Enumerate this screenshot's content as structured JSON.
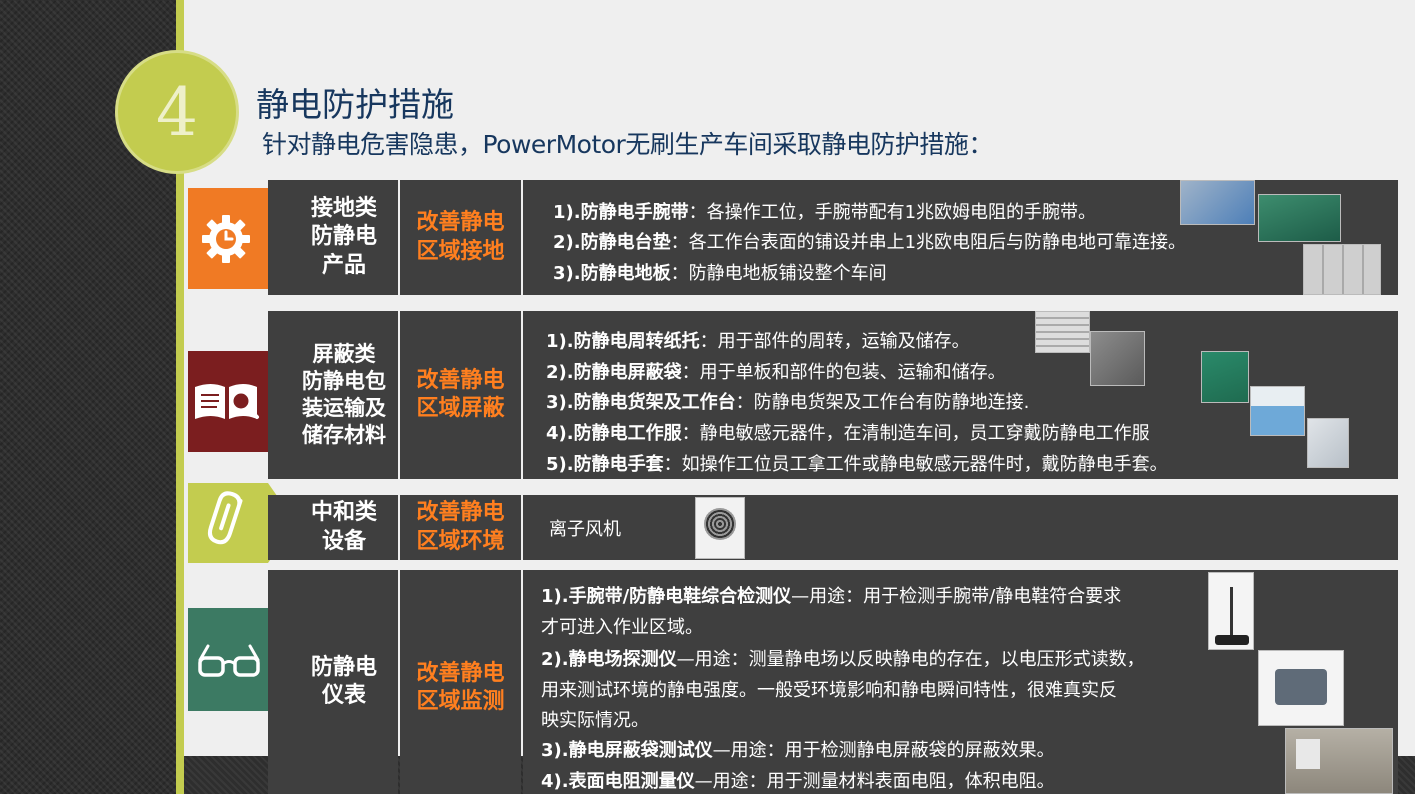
{
  "slide": {
    "number": "4",
    "title": "静电防护措施",
    "subtitle": "针对静电危害隐患，PowerMotor无刷生产车间采取静电防护措施："
  },
  "colors": {
    "accent_green": "#c3cc4f",
    "orange": "#f07a24",
    "dark_red": "#7b1e1f",
    "teal": "#3c7a63",
    "text_orange": "#ff7f1f",
    "cell_gray": "#3f3f3f",
    "title_navy": "#17375e"
  },
  "rows": [
    {
      "icon": "gear-clock-icon",
      "category": "接地类\n防静电\n产品",
      "goal": "改善静电\n区域接地",
      "items": [
        {
          "label": "1).防静电手腕带",
          "text": "：各操作工位，手腕带配有1兆欧姆电阻的手腕带。"
        },
        {
          "label": "2).防静电台垫",
          "text": "：各工作台表面的铺设并串上1兆欧电阻后与防静电地可靠连接。"
        },
        {
          "label": "3).防静电地板",
          "text": "：防静电地板铺设整个车间"
        }
      ]
    },
    {
      "icon": "book-search-icon",
      "category": "屏蔽类\n防静电包\n装运输及\n储存材料",
      "goal": "改善静电\n区域屏蔽",
      "items": [
        {
          "label": "1).防静电周转纸托",
          "text": "：用于部件的周转，运输及储存。"
        },
        {
          "label": "2).防静电屏蔽袋",
          "text": "：用于单板和部件的包装、运输和储存。"
        },
        {
          "label": "3).防静电货架及工作台",
          "text": "：防静电货架及工作台有防静地连接."
        },
        {
          "label": "4).防静电工作服",
          "text": "：静电敏感元器件，在清制造车间，员工穿戴防静电工作服"
        },
        {
          "label": "5).防静电手套",
          "text": "：如操作工位员工拿工件或静电敏感元器件时，戴防静电手套。"
        }
      ]
    },
    {
      "icon": "paperclip-icon",
      "category": "中和类\n设备",
      "goal": "改善静电\n区域环境",
      "items": [
        {
          "label": "",
          "text": "离子风机"
        }
      ]
    },
    {
      "icon": "glasses-icon",
      "category": "防静电\n仪表",
      "goal": "改善静电\n区域监测",
      "items": [
        {
          "label": "1).手腕带/防静电鞋综合检测仪",
          "text": "—用途：用于检测手腕带/静电鞋符合要求"
        },
        {
          "label": "",
          "text": "才可进入作业区域。"
        },
        {
          "label": "2).静电场探测仪",
          "text": "—用途：测量静电场以反映静电的存在，以电压形式读数，"
        },
        {
          "label": "",
          "text": "用来测试环境的静电强度。一般受环境影响和静电瞬间特性，很难真实反"
        },
        {
          "label": "",
          "text": "映实际情况。"
        },
        {
          "label": "3).静电屏蔽袋测试仪",
          "text": "—用途：用于检测静电屏蔽袋的屏蔽效果。"
        },
        {
          "label": "4).表面电阻测量仪",
          "text": "—用途：用于测量材料表面电阻，体积电阻。"
        }
      ]
    }
  ]
}
